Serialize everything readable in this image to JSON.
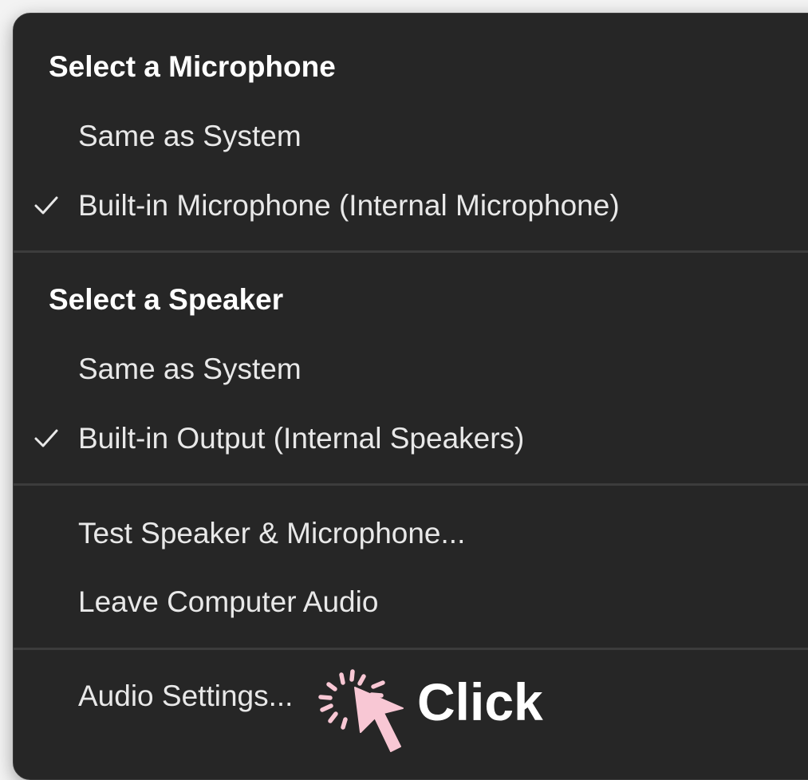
{
  "menu": {
    "microphone_section": {
      "header": "Select a Microphone",
      "items": [
        {
          "label": "Same as System",
          "checked": false
        },
        {
          "label": "Built-in Microphone (Internal Microphone)",
          "checked": true
        }
      ]
    },
    "speaker_section": {
      "header": "Select a Speaker",
      "items": [
        {
          "label": "Same as System",
          "checked": false
        },
        {
          "label": "Built-in Output (Internal Speakers)",
          "checked": true
        }
      ]
    },
    "actions": {
      "test_label": "Test Speaker & Microphone...",
      "leave_label": "Leave Computer Audio"
    },
    "settings": {
      "audio_settings_label": "Audio Settings..."
    }
  },
  "annotation": {
    "click_label": "Click",
    "color": "#f8c7d4"
  },
  "icons": [
    "checkmark-icon",
    "pointer-cursor-icon",
    "click-burst-icon"
  ],
  "colors": {
    "menu_background": "#262626",
    "header_text": "#ffffff",
    "item_text": "#e8e8e8",
    "separator": "#3c3c3c"
  }
}
